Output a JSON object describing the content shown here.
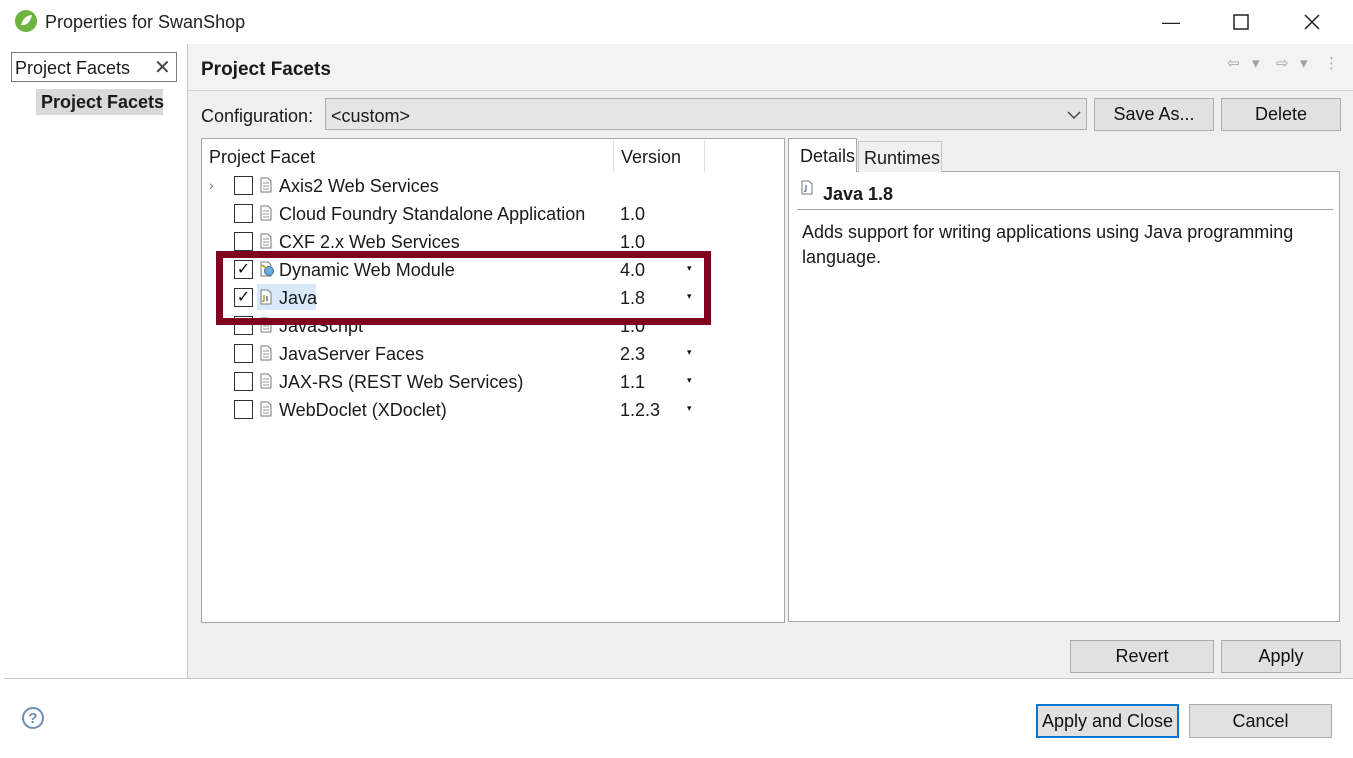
{
  "window": {
    "title": "Properties for SwanShop",
    "minimize_glyph": "—",
    "maximize_glyph": "☐",
    "close_glyph": "✕"
  },
  "sidebar": {
    "filter_value": "Project Facets",
    "filter_clear": "✕",
    "items": [
      {
        "label": "Project Facets",
        "selected": true
      }
    ]
  },
  "page": {
    "title": "Project Facets",
    "nav": {
      "back": "⇦",
      "dropdown": "▾",
      "forward": "⇨",
      "more": "⋮"
    }
  },
  "configuration": {
    "label": "Configuration:",
    "value": "<custom>",
    "save_as_label": "Save As...",
    "delete_label": "Delete"
  },
  "facets": {
    "column_facet": "Project Facet",
    "column_version": "Version",
    "rows": [
      {
        "name": "Axis2 Web Services",
        "version": "",
        "checked": false,
        "expandable": true
      },
      {
        "name": "Cloud Foundry Standalone Application",
        "version": "1.0",
        "checked": false
      },
      {
        "name": "CXF 2.x Web Services",
        "version": "1.0",
        "checked": false
      },
      {
        "name": "Dynamic Web Module",
        "version": "4.0",
        "checked": true,
        "has_dropdown": true
      },
      {
        "name": "Java",
        "version": "1.8",
        "checked": true,
        "has_dropdown": true,
        "selected": true
      },
      {
        "name": "JavaScript",
        "version": "1.0",
        "checked": false
      },
      {
        "name": "JavaServer Faces",
        "version": "2.3",
        "checked": false,
        "has_dropdown": true
      },
      {
        "name": "JAX-RS (REST Web Services)",
        "version": "1.1",
        "checked": false,
        "has_dropdown": true
      },
      {
        "name": "WebDoclet (XDoclet)",
        "version": "1.2.3",
        "checked": false,
        "has_dropdown": true
      }
    ],
    "check_glyph": "✓",
    "expand_glyph": "›",
    "dropdown_glyph": "▾"
  },
  "details": {
    "tabs": [
      "Details",
      "Runtimes"
    ],
    "title": "Java 1.8",
    "description": "Adds support for writing applications using Java programming language."
  },
  "actions": {
    "revert_label": "Revert",
    "apply_label": "Apply",
    "apply_close_label": "Apply and Close",
    "cancel_label": "Cancel",
    "help_glyph": "?"
  },
  "colors": {
    "highlight_box": "#800020",
    "selection": "#d9e9f9",
    "spring_green": "#6db33f"
  }
}
